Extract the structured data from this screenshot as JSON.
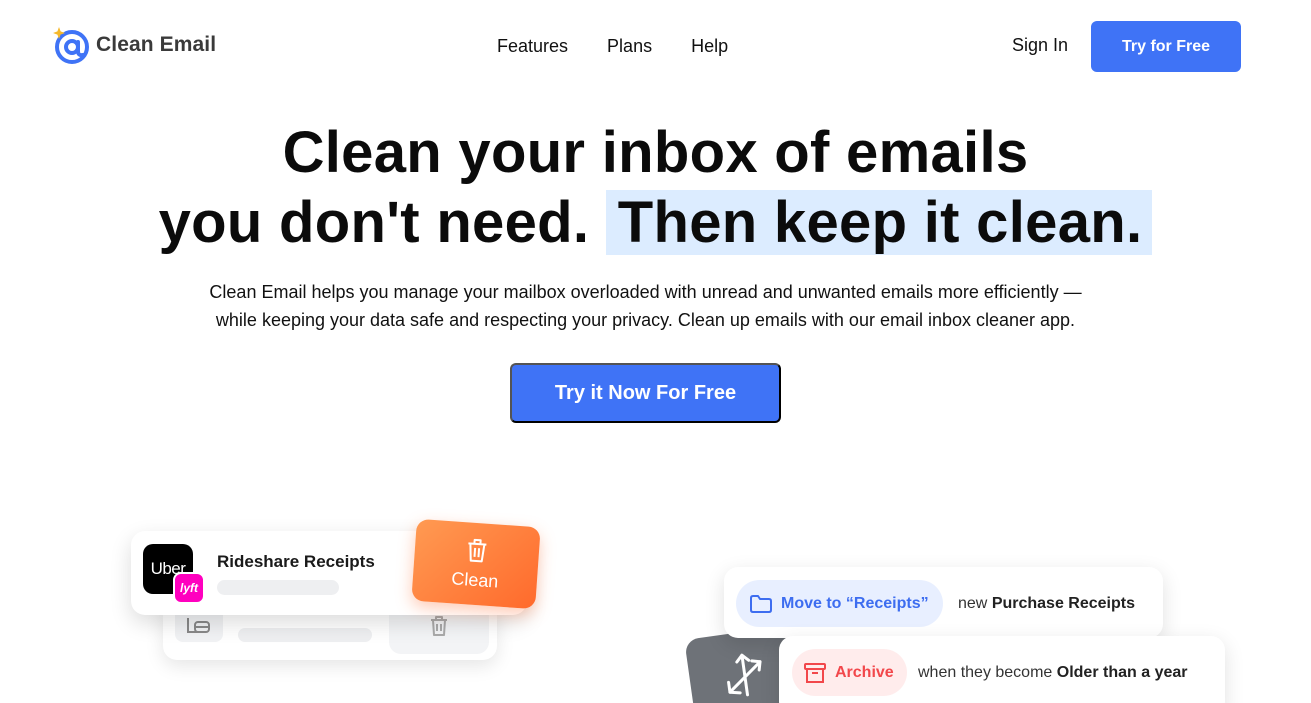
{
  "header": {
    "brand": "Clean Email",
    "nav": [
      "Features",
      "Plans",
      "Help"
    ],
    "sign_in": "Sign In",
    "try_free": "Try for Free"
  },
  "hero": {
    "title_line1": "Clean your inbox of emails",
    "title_line2a": "you don't need.",
    "title_line2b": "Then keep it clean.",
    "subtitle_line1": "Clean Email helps you manage your mailbox overloaded with unread and unwanted emails more efficiently —",
    "subtitle_line2": "while keeping your data safe and respecting your privacy. Clean up emails with our email inbox cleaner app.",
    "cta": "Try it Now For Free"
  },
  "illustration_left": {
    "uber_label": "Uber",
    "lyft_label": "lyft",
    "card_title": "Rideshare Receipts",
    "clean_label": "Clean"
  },
  "illustration_right": {
    "rule1": {
      "action": "Move to “Receipts”",
      "prefix": "new",
      "target": "Purchase Receipts"
    },
    "rule2": {
      "action": "Archive",
      "prefix": "when they become",
      "target": "Older than a year"
    }
  },
  "colors": {
    "brand_blue": "#3f73f6",
    "highlight": "#dcecff",
    "clean_orange": "#ff7a3a",
    "archive_red": "#f2474b",
    "lyft_pink": "#ff00bf"
  }
}
